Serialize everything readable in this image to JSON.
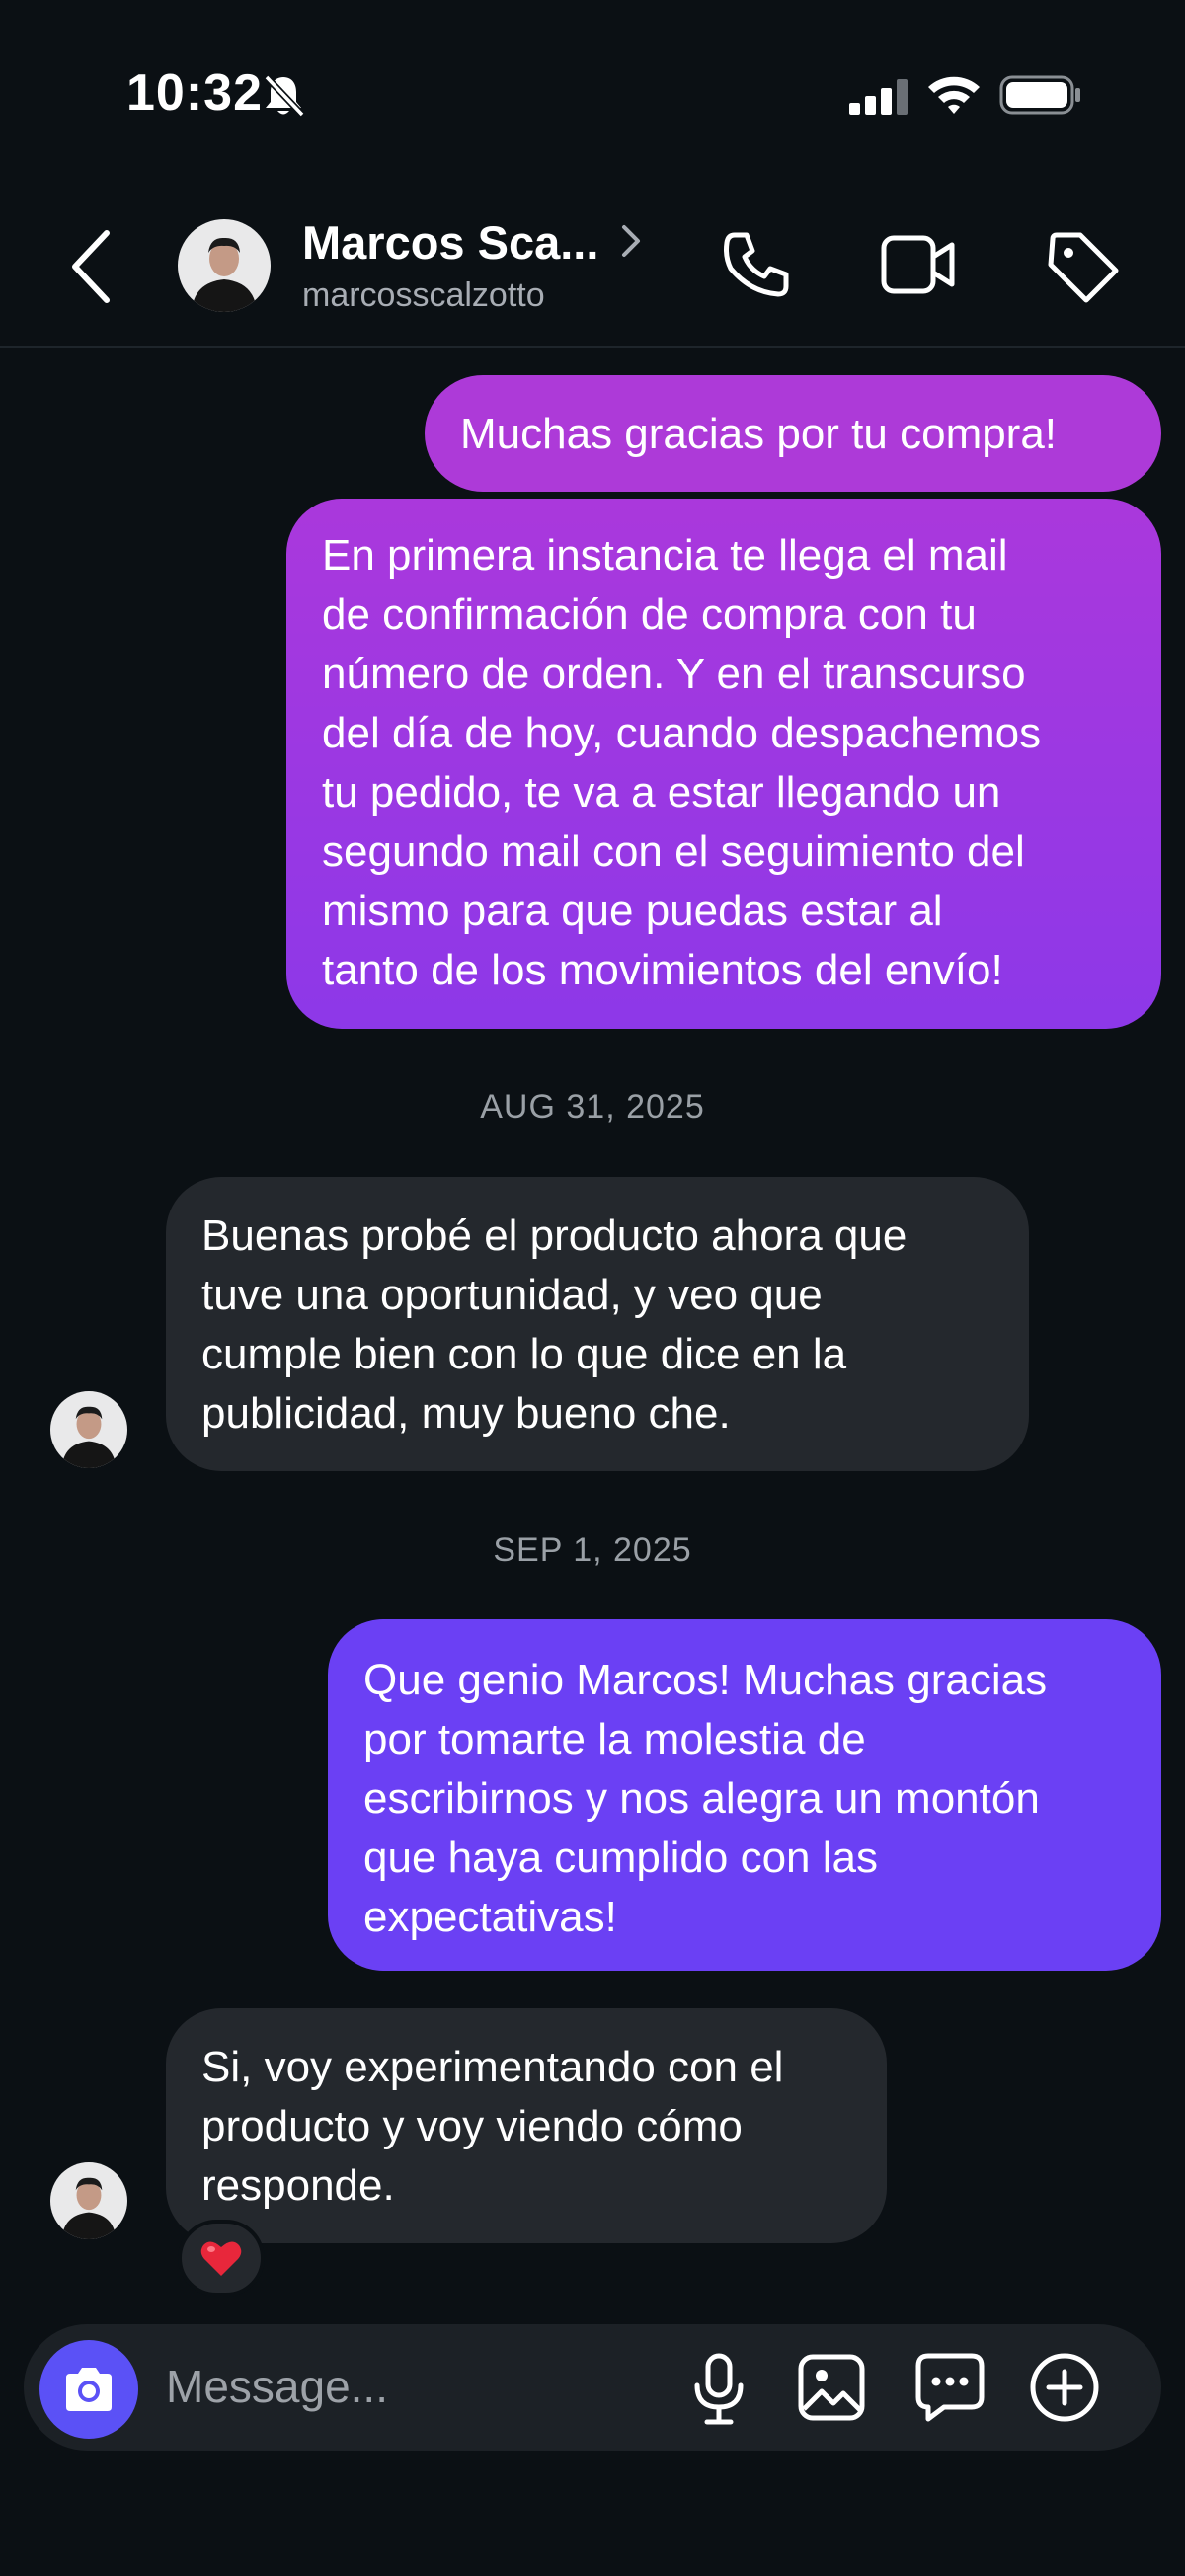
{
  "status_bar": {
    "time": "10:32"
  },
  "header": {
    "name": "Marcos Sca...",
    "username": "marcosscalzotto"
  },
  "messages": [
    {
      "direction": "outgoing",
      "lines": [
        "Muchas gracias por tu compra!"
      ]
    },
    {
      "direction": "outgoing",
      "lines": [
        "En primera instancia te llega el mail",
        "de confirmación de compra con tu",
        "número de orden. Y en el transcurso",
        "del día de hoy, cuando despachemos",
        "tu pedido, te va a estar llegando un",
        "segundo mail con el seguimiento del",
        "mismo para que puedas estar al",
        "tanto de los movimientos del envío!"
      ]
    },
    {
      "direction": "incoming",
      "lines": [
        "Buenas probé el producto ahora que",
        "tuve una oportunidad, y veo que",
        "cumple bien con lo que dice en la",
        "publicidad, muy bueno che."
      ]
    },
    {
      "direction": "outgoing",
      "lines": [
        "Que genio Marcos! Muchas gracias",
        "por tomarte la molestia de",
        "escribirnos y nos alegra un montón",
        "que haya cumplido con las",
        "expectativas!"
      ]
    },
    {
      "direction": "incoming",
      "reaction": "heart-emoji",
      "lines": [
        "Si, voy experimentando con el",
        "producto y voy viendo cómo",
        "responde."
      ]
    }
  ],
  "dates": [
    "AUG 31, 2025",
    "SEP 1, 2025"
  ],
  "composer": {
    "placeholder": "Message..."
  },
  "icons": {
    "status": [
      "bell-slash-icon",
      "signal-icon",
      "wifi-icon",
      "battery-icon"
    ],
    "header": [
      "back-chevron-icon",
      "chevron-right-icon",
      "phone-icon",
      "video-camera-icon",
      "tag-icon"
    ],
    "composer": [
      "camera-icon",
      "microphone-icon",
      "image-icon",
      "sticker-message-icon",
      "plus-circle-icon"
    ]
  },
  "colors": {
    "background": "#0b1014",
    "outgoing_top": "#ad3ad8",
    "outgoing_bottom": "#6b40f4",
    "incoming": "#24282d",
    "camera_button": "#5b51f6"
  }
}
